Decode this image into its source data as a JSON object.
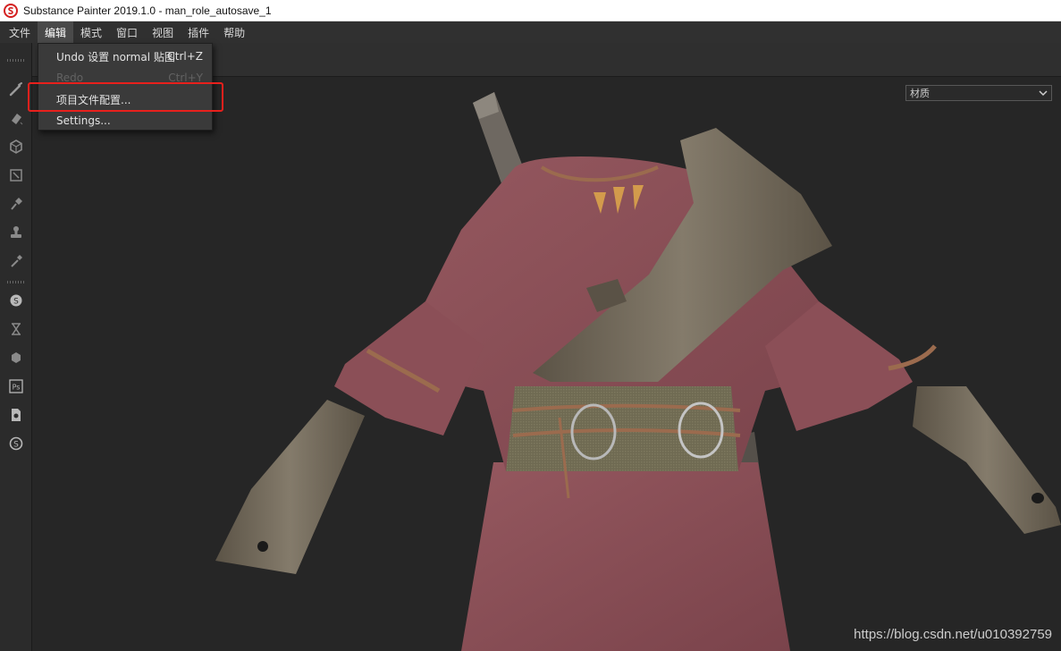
{
  "window": {
    "title": "Substance Painter 2019.1.0 - man_role_autosave_1"
  },
  "menubar": {
    "items": [
      {
        "label": "文件"
      },
      {
        "label": "编辑",
        "active": true
      },
      {
        "label": "模式"
      },
      {
        "label": "窗口"
      },
      {
        "label": "视图"
      },
      {
        "label": "插件"
      },
      {
        "label": "帮助"
      }
    ]
  },
  "edit_menu": {
    "items": [
      {
        "label": "Undo 设置 normal 贴图",
        "shortcut": "Ctrl+Z",
        "enabled": true
      },
      {
        "label": "Redo",
        "shortcut": "Ctrl+Y",
        "enabled": false
      },
      {
        "label": "项目文件配置...",
        "shortcut": "",
        "enabled": true,
        "highlighted": true
      },
      {
        "label": "Settings...",
        "shortcut": "",
        "enabled": true
      }
    ]
  },
  "viewport": {
    "channel_select": {
      "value": "材质"
    }
  },
  "left_toolbar": {
    "tools": [
      "paint-brush-icon",
      "eraser-icon",
      "projection-cube-icon",
      "polygon-fill-icon",
      "smudge-icon",
      "clone-stamp-icon",
      "color-picker-icon",
      "substance-s-icon",
      "hourglass-icon",
      "substance-cube-icon",
      "photoshop-icon",
      "document-export-icon",
      "substance-circle-icon"
    ]
  },
  "watermark": {
    "text": "https://blog.csdn.net/u010392759"
  },
  "colors": {
    "highlight": "#e8201c",
    "menubar_bg": "#303030",
    "viewport_bg": "#262626",
    "cloth": "#8a4f58",
    "leather": "#6e6455",
    "belt": "#6f6a52"
  }
}
